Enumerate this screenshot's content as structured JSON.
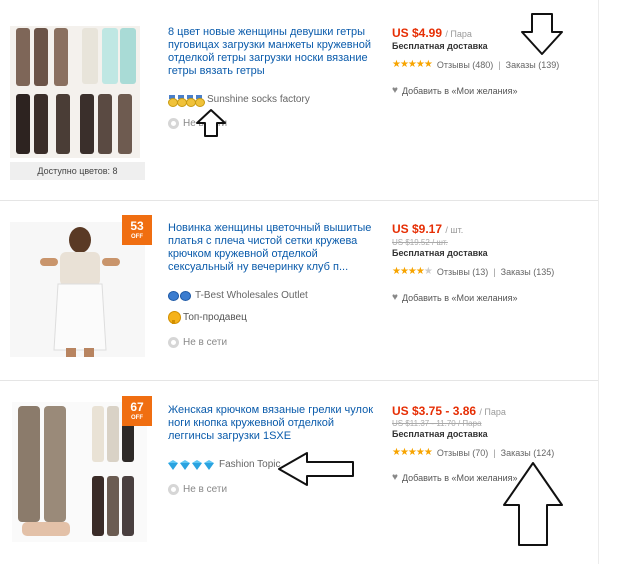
{
  "colors": {
    "link": "#0a5bab",
    "price": "#e62e04",
    "discount": "#f06e11",
    "star": "#f7a400"
  },
  "items": [
    {
      "title": "8 цвет новые женщины девушки гетры пуговицах загрузки манжеты кружевной отделкой гетры загрузки носки вязание гетры вязать гетры",
      "seller": "Sunshine socks factory",
      "seller_badge": "medal-icons",
      "online": "Не в сети",
      "colors_available": "Доступно цветов: 8",
      "price": "US $4.99",
      "unit": "/ Пара",
      "old_price": "",
      "shipping": "Бесплатная доставка",
      "stars": 5,
      "reviews": "Отзывы (480)",
      "orders": "Заказы (139)",
      "wishlist": "Добавить в «Мои желания»"
    },
    {
      "title": "Новинка женщины цветочный вышитые платья с плеча чистой сетки кружева крючком кружевной отделкой сексуальный ну вечеринку клуб п...",
      "seller": "T-Best Wholesales Outlet",
      "seller_badge": "crown-icons",
      "top_seller": "Топ-продавец",
      "online": "Не в сети",
      "discount": "53",
      "discount_off": "OFF",
      "price": "US $9.17",
      "unit": "/ шт.",
      "old_price": "US $19.52 / шт.",
      "shipping": "Бесплатная доставка",
      "stars": 4,
      "reviews": "Отзывы (13)",
      "orders": "Заказы (135)",
      "wishlist": "Добавить в «Мои желания»"
    },
    {
      "title": "Женская крючком вязаные грелки чулок ноги кнопка кружевной отделкой леггинсы загрузки 1SXE",
      "seller": "Fashion Topic",
      "seller_badge": "diamond-icons",
      "online": "Не в сети",
      "discount": "67",
      "discount_off": "OFF",
      "price": "US $3.75 - 3.86",
      "unit": "/ Пара",
      "old_price": "US $11.37 - 11.70 / Пара",
      "shipping": "Бесплатная доставка",
      "stars": 5,
      "reviews": "Отзывы (70)",
      "orders": "Заказы (124)",
      "wishlist": "Добавить в «Мои желания»"
    }
  ]
}
